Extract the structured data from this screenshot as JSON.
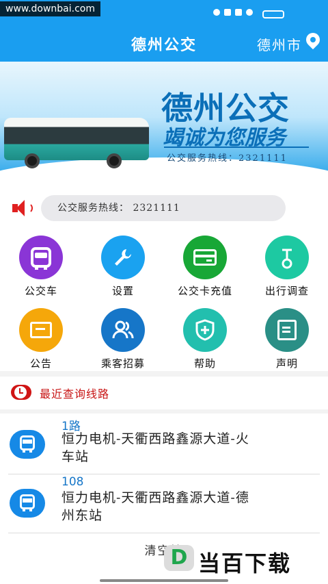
{
  "watermark": "www.downbai.com",
  "app_bar": {
    "title": "德州公交",
    "city": "德州市"
  },
  "banner": {
    "title": "德州公交",
    "slogan": "竭诚为您服务",
    "hotline": "公交服务热线：2321111"
  },
  "notice": {
    "text": "公交服务热线：  2321111"
  },
  "menu": [
    {
      "label": "公交车",
      "color": "#8a35d6",
      "icon": "bus-icon"
    },
    {
      "label": "设置",
      "color": "#1aa2f0",
      "icon": "wrench-icon"
    },
    {
      "label": "公交卡充值",
      "color": "#18a736",
      "icon": "card-icon"
    },
    {
      "label": "出行调查",
      "color": "#1dc9a2",
      "icon": "bicycle-icon"
    },
    {
      "label": "公告",
      "color": "#f5a70a",
      "icon": "message-icon"
    },
    {
      "label": "乘客招募",
      "color": "#1676c8",
      "icon": "users-icon"
    },
    {
      "label": "帮助",
      "color": "#22bfae",
      "icon": "shield-plus-icon"
    },
    {
      "label": "声明",
      "color": "#2a8f86",
      "icon": "document-edit-icon"
    }
  ],
  "recent": {
    "title": "最近查询线路",
    "routes": [
      {
        "number": "1路",
        "name": "恒力电机-天衢西路鑫源大道-火车站"
      },
      {
        "number": "108",
        "name": "恒力电机-天衢西路鑫源大道-德州东站"
      }
    ],
    "clear_label": "清空搜"
  },
  "brand": {
    "mark": "D",
    "text": "当百下载"
  }
}
